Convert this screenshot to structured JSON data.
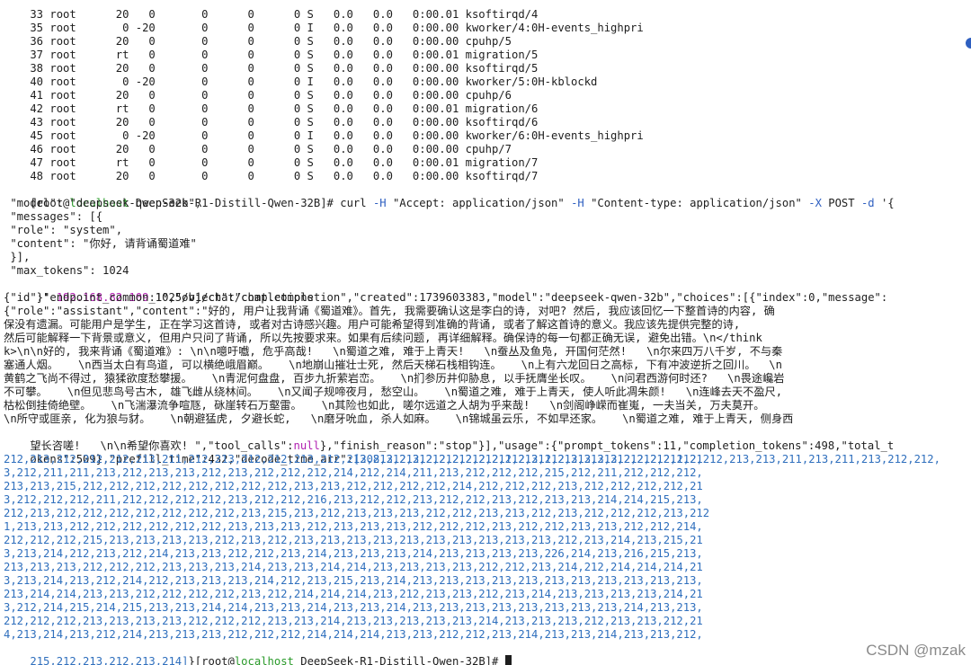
{
  "process_rows": [
    "    33 root      20   0       0      0      0 S   0.0   0.0   0:00.01 ksoftirqd/4",
    "    35 root       0 -20       0      0      0 I   0.0   0.0   0:00.00 kworker/4:0H-events_highpri",
    "    36 root      20   0       0      0      0 S   0.0   0.0   0:00.00 cpuhp/5",
    "    37 root      rt   0       0      0      0 S   0.0   0.0   0:00.01 migration/5",
    "    38 root      20   0       0      0      0 S   0.0   0.0   0:00.00 ksoftirqd/5",
    "    40 root       0 -20       0      0      0 I   0.0   0.0   0:00.00 kworker/5:0H-kblockd",
    "    41 root      20   0       0      0      0 S   0.0   0.0   0:00.00 cpuhp/6",
    "    42 root      rt   0       0      0      0 S   0.0   0.0   0:00.01 migration/6",
    "    43 root      20   0       0      0      0 S   0.0   0.0   0:00.00 ksoftirqd/6",
    "    45 root       0 -20       0      0      0 I   0.0   0.0   0:00.00 kworker/6:0H-events_highpri",
    "    46 root      20   0       0      0      0 S   0.0   0.0   0:00.00 cpuhp/7",
    "    47 root      rt   0       0      0      0 S   0.0   0.0   0:00.01 migration/7",
    "    48 root      20   0       0      0      0 S   0.0   0.0   0:00.00 ksoftirqd/7"
  ],
  "prompt": {
    "open": "[root@",
    "host": "localhost",
    "dir": " DeepSeek-R1-Distill-Qwen-32B]# ",
    "cmd1": "curl ",
    "opt_h1": "-H ",
    "accept": "\"Accept: application/json\" ",
    "opt_h2": "-H ",
    "ctype": "\"Content-type: application/json\" ",
    "opt_x": "-X ",
    "post": "POST ",
    "opt_d": "-d ",
    "quote": "'{"
  },
  "body_lines": [
    " \"model\": \"deepseek-qwen-32b\",",
    " \"messages\": [{",
    " \"role\": \"system\",",
    " \"content\": \"你好, 请背诵蜀道难\"",
    " }],",
    " \"max_tokens\": 1024"
  ],
  "url_line": {
    "pre": " }' ",
    "ip": "192.168.82.109",
    "rest": ":1025/v1/chat/completions"
  },
  "response_lines": [
    "{\"id\":\"endpoint_common_1\",\"object\":\"chat.completion\",\"created\":1739603383,\"model\":\"deepseek-qwen-32b\",\"choices\":[{\"index\":0,\"message\":",
    "{\"role\":\"assistant\",\"content\":\"好的, 用户让我背诵《蜀道难》。首先, 我需要确认这是李白的诗, 对吧? 然后, 我应该回忆一下整首诗的内容, 确",
    "保没有遗漏。可能用户是学生, 正在学习这首诗, 或者对古诗感兴趣。用户可能希望得到准确的背诵, 或者了解这首诗的意义。我应该先提供完整的诗,",
    "然后可能解释一下背景或意义, 但用户只问了背诵, 所以先按要求来。如果有后续问题, 再详细解释。确保诗的每一句都正确无误, 避免出错。\\n</think",
    "k>\\n\\n好的, 我来背诵《蜀道难》: \\n\\n噫吁嚱, 危乎高哉!   \\n蜀道之难, 难于上青天!   \\n蚕丛及鱼凫, 开国何茫然!   \\n尔来四万八千岁, 不与秦",
    "塞通人烟。   \\n西当太白有鸟道, 可以横绝峨眉巅。   \\n地崩山摧壮士死, 然后天梯石栈相钩连。   \\n上有六龙回日之高标, 下有冲波逆折之回川。  \\n",
    "黄鹤之飞尚不得过, 猿猱欲度愁攀援。   \\n青泥何盘盘, 百步九折萦岩峦。   \\n扪参历井仰胁息, 以手抚膺坐长叹。   \\n问君西游何时还?   \\n畏途巉岩",
    "不可攀。   \\n但见悲鸟号古木, 雄飞雌从绕林间。   \\n又闻子规啼夜月, 愁空山。   \\n蜀道之难, 难于上青天, 使人听此凋朱颜!   \\n连峰去天不盈尺,",
    "枯松倒挂倚绝壁。   \\n飞湍瀑流争喧豗, 砯崖转石万壑雷。   \\n其险也如此, 嗟尔远道之人胡为乎来哉!   \\n剑阁峥嵘而崔嵬, 一夫当关, 万夫莫开。",
    "\\n所守或匪亲, 化为狼与豺。   \\n朝避猛虎, 夕避长蛇,   \\n磨牙吮血, 杀人如麻。   \\n锦城虽云乐, 不如早还家。   \\n蜀道之难, 难于上青天, 侧身西",
    "望长咨嗟!   \\n\\n希望你喜欢! \",\"tool_calls\":",
    "okens\":509},\"prefill_time\":432,\"decode_time_arr\":"
  ],
  "response_tail": {
    "null": "null",
    "after_null": "},\"finish_reason\":\"stop\"}],\"usage\":{\"prompt_tokens\":11,\"completion_tokens\":498,\"total_t",
    "arr_start": "[308,212,212,212,212,211,213,212,213,213,212,212,212,212,213,213,211,213,211,213,212,212,"
  },
  "decode_lines": [
    "212,213,212,212,212,213,211,212,213,212,212,213,212,212,213,213,212,212,212,212,211,213,213,212,212,211,21",
    "3,212,211,211,213,212,213,213,212,213,212,212,212,214,212,214,211,213,212,212,212,215,212,211,212,212,212,",
    "213,213,215,212,212,212,212,212,212,212,212,213,213,212,212,212,212,214,212,212,212,213,212,212,212,212,21",
    "3,212,212,212,211,212,212,212,212,213,212,212,216,213,212,212,213,212,212,213,212,213,213,214,214,215,213,",
    "212,213,212,212,212,212,212,212,212,213,215,213,212,213,213,213,212,212,213,213,212,213,212,212,212,213,212",
    "1,213,213,212,212,212,212,212,212,213,213,213,212,213,213,213,212,212,212,213,212,212,213,213,212,212,214,",
    "212,212,212,215,213,213,213,213,212,213,212,213,213,213,213,213,213,213,213,213,213,212,213,214,213,215,21",
    "3,213,214,212,213,212,214,213,213,212,212,213,214,213,213,213,214,213,213,213,213,226,214,213,216,215,213,",
    "213,213,213,212,212,212,213,213,213,214,213,213,214,214,213,213,213,213,212,212,213,214,212,214,214,214,21",
    "3,213,214,213,212,214,212,213,213,213,214,212,213,215,213,214,213,213,213,213,213,213,213,213,213,213,213,",
    "213,214,214,213,213,212,212,212,212,213,212,214,214,214,213,212,213,213,212,213,214,213,213,213,213,214,21",
    "3,212,214,215,214,215,213,213,214,214,213,213,214,213,213,214,213,213,213,213,213,213,213,213,214,213,213,",
    "212,212,212,213,213,213,213,212,212,212,213,213,214,213,213,213,213,213,214,213,213,213,212,213,213,212,21",
    "4,213,214,213,212,214,213,213,213,212,212,212,214,214,214,213,213,212,212,213,214,213,213,214,213,213,212,"
  ],
  "last_line": {
    "arr_end": "215,212,213,212,213,214]",
    "after": "}[root@",
    "host": "localhost",
    "dir": " DeepSeek-R1-Distill-Qwen-32B]# "
  },
  "watermark": "CSDN @mzak"
}
